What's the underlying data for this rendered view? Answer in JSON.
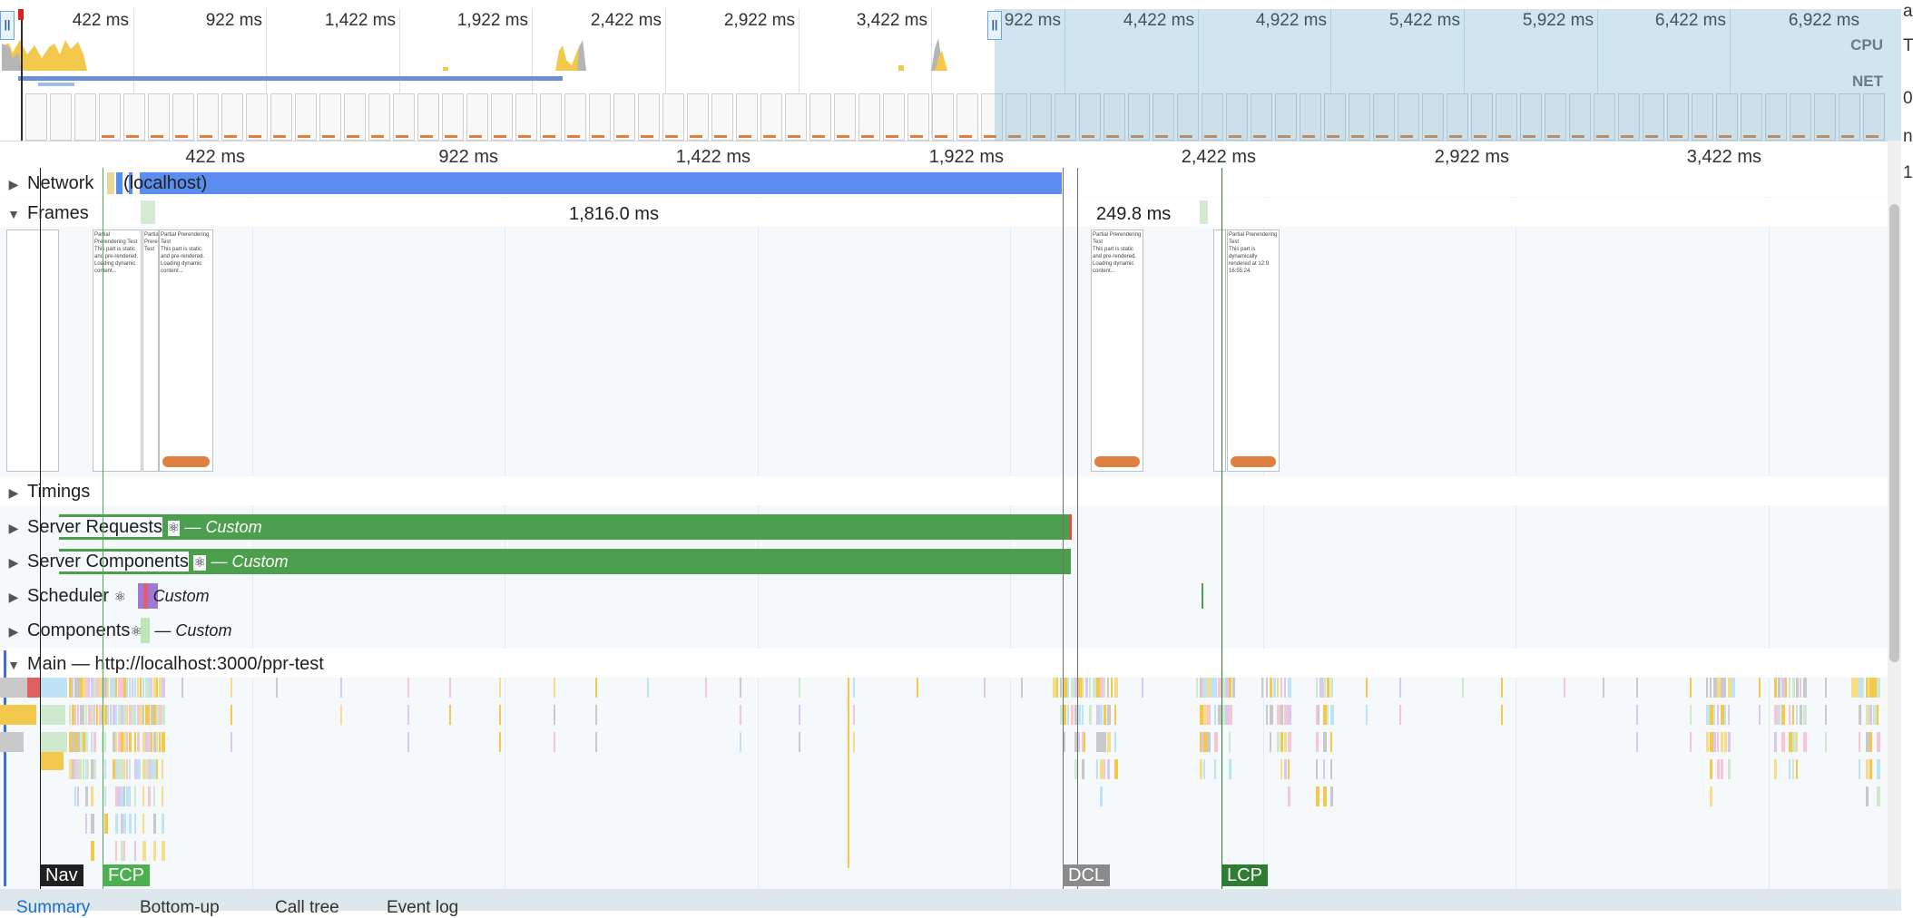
{
  "overview": {
    "tick_labels": [
      "422 ms",
      "922 ms",
      "1,422 ms",
      "1,922 ms",
      "2,422 ms",
      "2,922 ms",
      "3,422 ms",
      "922 ms",
      "4,422 ms",
      "4,922 ms",
      "5,422 ms",
      "5,922 ms",
      "6,422 ms",
      "6,922 ms"
    ],
    "cpu_label": "CPU",
    "net_label": "NET"
  },
  "ruler": {
    "tick_labels": [
      "422 ms",
      "922 ms",
      "1,422 ms",
      "1,922 ms",
      "2,422 ms",
      "2,922 ms",
      "3,422 ms"
    ]
  },
  "tracks": {
    "network": {
      "label": "Network",
      "request": "(localhost)"
    },
    "frames": {
      "label": "Frames",
      "duration_1": "1,816.0 ms",
      "duration_2": "249.8 ms"
    },
    "timings": {
      "label": "Timings"
    },
    "server_requests": {
      "label": "Server Requests",
      "suffix": "— Custom"
    },
    "server_components": {
      "label": "Server Components",
      "suffix": "— Custom"
    },
    "scheduler": {
      "label": "Scheduler",
      "suffix": "Custom"
    },
    "components": {
      "label": "Components",
      "suffix": "— Custom"
    },
    "main": {
      "label": "Main — http://localhost:3000/ppr-test"
    }
  },
  "frame_text": {
    "title": "Partial Prerendering Test",
    "static": "This part is static and pre-rendered.",
    "loading": "Loading dynamic content...",
    "dynamic": "This part is dynamically rendered at 12:9 16:55:24."
  },
  "markers": {
    "nav": "Nav",
    "fcp": "FCP",
    "dcl": "DCL",
    "lcp": "LCP"
  },
  "bottom_tabs": [
    "Summary",
    "Bottom-up",
    "Call tree",
    "Event log"
  ],
  "edge_glyphs": [
    "a",
    "T",
    "0",
    "n",
    "1"
  ],
  "colors": {
    "network_bar": "#5b8def",
    "custom_green": "#4c9f4c",
    "scripting_yellow": "#f2c94c",
    "marker_dark": "#202020",
    "marker_fcp": "#4caf50",
    "marker_dcl": "#8a8a8a",
    "marker_lcp": "#2e7d32"
  }
}
